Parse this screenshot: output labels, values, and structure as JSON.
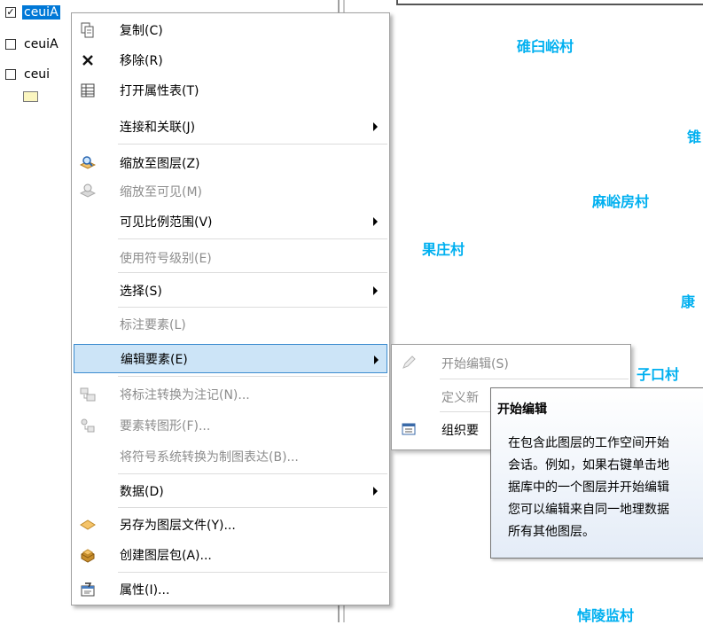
{
  "toc": {
    "layers": [
      {
        "name": "ceuiA",
        "checked": true,
        "selected": true
      },
      {
        "name": "ceuiA",
        "checked": false,
        "selected": false
      },
      {
        "name": "ceui",
        "checked": false,
        "selected": false
      }
    ],
    "swatch_color": "#fbf6c0"
  },
  "map": {
    "villages": [
      "碓臼峪村",
      "锥",
      "麻峪房村",
      "果庄村",
      "康",
      "子口村",
      "悼陵监村"
    ],
    "label_color": "#00b0f0"
  },
  "context_menu": {
    "items": [
      {
        "label": "复制(C)",
        "icon": "copy-icon",
        "enabled": true
      },
      {
        "label": "移除(R)",
        "icon": "remove-x-icon",
        "enabled": true
      },
      {
        "label": "打开属性表(T)",
        "icon": "table-icon",
        "enabled": true
      },
      {
        "label": "连接和关联(J)",
        "enabled": true,
        "submenu": true
      },
      {
        "label": "缩放至图层(Z)",
        "icon": "zoom-to-layer-icon",
        "enabled": true
      },
      {
        "label": "缩放至可见(M)",
        "icon": "zoom-to-visible-icon",
        "enabled": false
      },
      {
        "label": "可见比例范围(V)",
        "enabled": true,
        "submenu": true
      },
      {
        "label": "使用符号级别(E)",
        "enabled": false
      },
      {
        "label": "选择(S)",
        "enabled": true,
        "submenu": true
      },
      {
        "label": "标注要素(L)",
        "enabled": false
      },
      {
        "label": "编辑要素(E)",
        "enabled": true,
        "submenu": true,
        "highlighted": true
      },
      {
        "label": "将标注转换为注记(N)...",
        "icon": "convert-labels-icon",
        "enabled": false
      },
      {
        "label": "要素转图形(F)...",
        "icon": "features-to-graphics-icon",
        "enabled": false
      },
      {
        "label": "将符号系统转换为制图表达(B)...",
        "enabled": false
      },
      {
        "label": "数据(D)",
        "enabled": true,
        "submenu": true
      },
      {
        "label": "另存为图层文件(Y)...",
        "icon": "layer-file-icon",
        "enabled": true
      },
      {
        "label": "创建图层包(A)...",
        "icon": "layer-package-icon",
        "enabled": true
      },
      {
        "label": "属性(I)...",
        "icon": "properties-icon",
        "enabled": true
      }
    ]
  },
  "submenu": {
    "items": [
      {
        "label": "开始编辑(S)",
        "icon": "edit-pencil-icon",
        "enabled": false
      },
      {
        "label": "定义新",
        "enabled": false
      },
      {
        "label": "组织要",
        "icon": "organize-features-icon",
        "enabled": true
      }
    ]
  },
  "tooltip": {
    "title": "开始编辑",
    "lines": [
      "在包含此图层的工作空间开始",
      "会话。例如，如果右键单击地",
      "据库中的一个图层并开始编辑",
      "您可以编辑来自同一地理数据",
      "所有其他图层。"
    ]
  },
  "colors": {
    "highlight_bg": "#cce4f7",
    "highlight_border": "#3c8ccf",
    "selection_blue": "#0078d7",
    "disabled_text": "#8d8d8d"
  }
}
